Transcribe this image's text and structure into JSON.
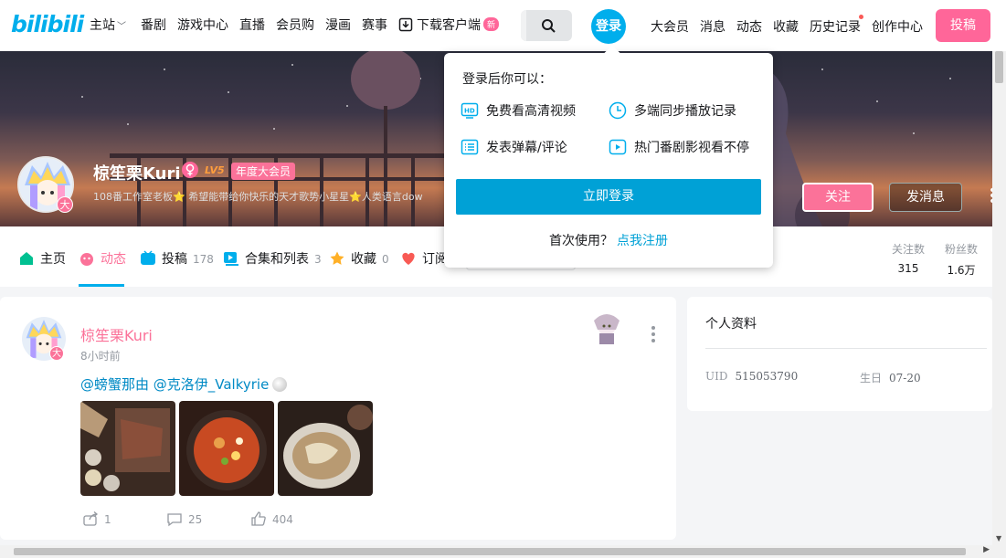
{
  "brand": {
    "logo_text": "bilibili",
    "accent": "#00aeec",
    "pink": "#fb7299"
  },
  "nav": {
    "items": [
      "主站",
      "番剧",
      "游戏中心",
      "直播",
      "会员购",
      "漫画",
      "赛事"
    ],
    "download_label": "下载客户端",
    "new_badge": "新",
    "login_label": "登录",
    "right_items": [
      "大会员",
      "消息",
      "动态",
      "收藏",
      "历史记录",
      "创作中心"
    ],
    "upload_label": "投稿"
  },
  "user": {
    "name": "椋笙栗Kuri",
    "level": "LV5",
    "vip_label": "年度大会员",
    "vip_badge": "大",
    "sign": "108番工作室老板⭐ 希望能带给你快乐的天才歌势小星星⭐人类语言dow",
    "follow_label": "关注",
    "message_label": "发消息"
  },
  "tabs": [
    {
      "label": "主页",
      "count": ""
    },
    {
      "label": "动态",
      "count": ""
    },
    {
      "label": "投稿",
      "count": "178"
    },
    {
      "label": "合集和列表",
      "count": "3"
    },
    {
      "label": "收藏",
      "count": "0"
    },
    {
      "label": "订阅",
      "count": ""
    }
  ],
  "stats": [
    {
      "label": "关注数",
      "value": "315"
    },
    {
      "label": "粉丝数",
      "value": "1.6万"
    }
  ],
  "post": {
    "author": "椋笙栗Kuri",
    "time": "8小时前",
    "text": "@螃蟹那由 @克洛伊_Valkyrie",
    "actions": {
      "share": "1",
      "comment": "25",
      "like": "404"
    }
  },
  "profile": {
    "title": "个人资料",
    "uid_label": "UID",
    "uid": "515053790",
    "birthday_label": "生日",
    "birthday": "07-20"
  },
  "login_popup": {
    "title": "登录后你可以：",
    "features": [
      "免费看高清视频",
      "多端同步播放记录",
      "发表弹幕/评论",
      "热门番剧影视看不停"
    ],
    "login_button": "立即登录",
    "first_use": "首次使用？",
    "register_link": "点我注册"
  }
}
